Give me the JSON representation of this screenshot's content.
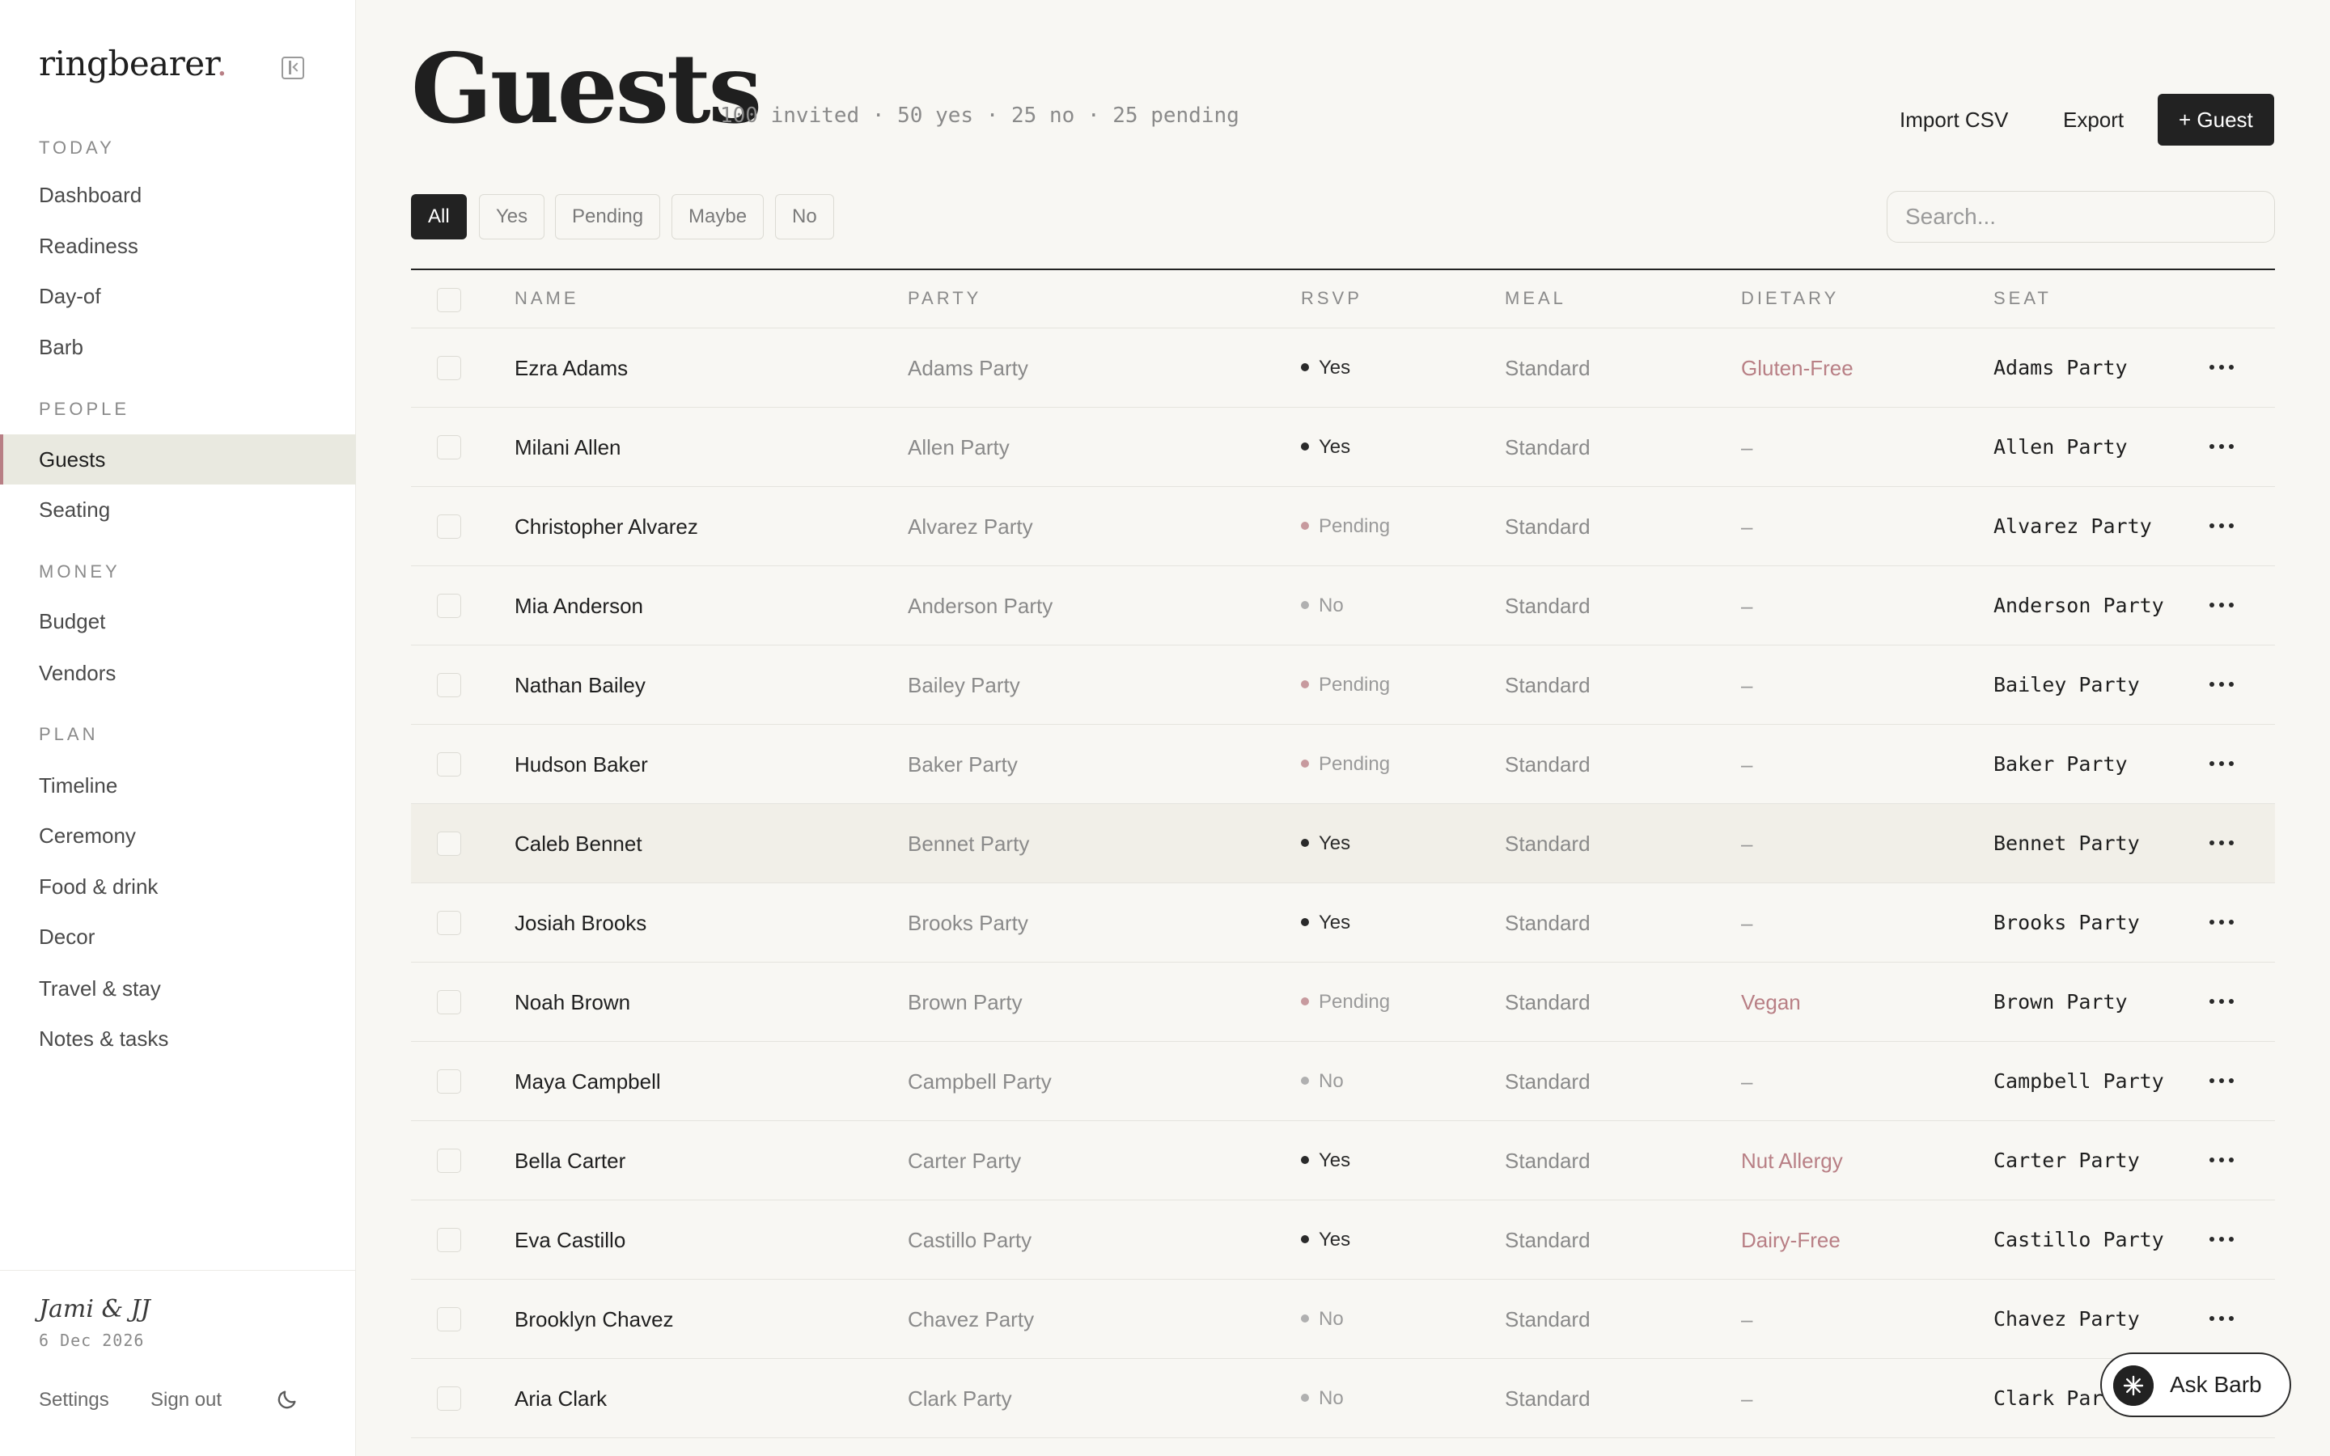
{
  "brand": {
    "name": "ringbearer",
    "dot": "."
  },
  "sidebar": {
    "sections": [
      {
        "title": "TODAY",
        "items": [
          "Dashboard",
          "Readiness",
          "Day-of",
          "Barb"
        ]
      },
      {
        "title": "PEOPLE",
        "items": [
          "Guests",
          "Seating"
        ]
      },
      {
        "title": "MONEY",
        "items": [
          "Budget",
          "Vendors"
        ]
      },
      {
        "title": "PLAN",
        "items": [
          "Timeline",
          "Ceremony",
          "Food & drink",
          "Decor",
          "Travel & stay",
          "Notes & tasks"
        ]
      }
    ],
    "active_item": "Guests",
    "footer": {
      "couple": "Jami & JJ",
      "date": "6 Dec 2026",
      "settings_label": "Settings",
      "signout_label": "Sign out"
    }
  },
  "header": {
    "title": "Guests",
    "stats": "100 invited · 50 yes · 25 no · 25 pending",
    "import_label": "Import CSV",
    "export_label": "Export",
    "add_label": "+ Guest"
  },
  "filters": {
    "options": [
      "All",
      "Yes",
      "Pending",
      "Maybe",
      "No"
    ],
    "selected": "All"
  },
  "search": {
    "placeholder": "Search...",
    "value": ""
  },
  "table": {
    "columns": [
      "NAME",
      "PARTY",
      "RSVP",
      "MEAL",
      "DIETARY",
      "SEAT"
    ],
    "rows": [
      {
        "name": "Ezra Adams",
        "party": "Adams Party",
        "rsvp": "Yes",
        "meal": "Standard",
        "dietary": "Gluten-Free",
        "seat": "Adams Party"
      },
      {
        "name": "Milani Allen",
        "party": "Allen Party",
        "rsvp": "Yes",
        "meal": "Standard",
        "dietary": "–",
        "seat": "Allen Party"
      },
      {
        "name": "Christopher Alvarez",
        "party": "Alvarez Party",
        "rsvp": "Pending",
        "meal": "Standard",
        "dietary": "–",
        "seat": "Alvarez Party"
      },
      {
        "name": "Mia Anderson",
        "party": "Anderson Party",
        "rsvp": "No",
        "meal": "Standard",
        "dietary": "–",
        "seat": "Anderson Party"
      },
      {
        "name": "Nathan Bailey",
        "party": "Bailey Party",
        "rsvp": "Pending",
        "meal": "Standard",
        "dietary": "–",
        "seat": "Bailey Party"
      },
      {
        "name": "Hudson Baker",
        "party": "Baker Party",
        "rsvp": "Pending",
        "meal": "Standard",
        "dietary": "–",
        "seat": "Baker Party"
      },
      {
        "name": "Caleb Bennet",
        "party": "Bennet Party",
        "rsvp": "Yes",
        "meal": "Standard",
        "dietary": "–",
        "seat": "Bennet Party"
      },
      {
        "name": "Josiah Brooks",
        "party": "Brooks Party",
        "rsvp": "Yes",
        "meal": "Standard",
        "dietary": "–",
        "seat": "Brooks Party"
      },
      {
        "name": "Noah Brown",
        "party": "Brown Party",
        "rsvp": "Pending",
        "meal": "Standard",
        "dietary": "Vegan",
        "seat": "Brown Party"
      },
      {
        "name": "Maya Campbell",
        "party": "Campbell Party",
        "rsvp": "No",
        "meal": "Standard",
        "dietary": "–",
        "seat": "Campbell Party"
      },
      {
        "name": "Bella Carter",
        "party": "Carter Party",
        "rsvp": "Yes",
        "meal": "Standard",
        "dietary": "Nut Allergy",
        "seat": "Carter Party"
      },
      {
        "name": "Eva Castillo",
        "party": "Castillo Party",
        "rsvp": "Yes",
        "meal": "Standard",
        "dietary": "Dairy-Free",
        "seat": "Castillo Party"
      },
      {
        "name": "Brooklyn Chavez",
        "party": "Chavez Party",
        "rsvp": "No",
        "meal": "Standard",
        "dietary": "–",
        "seat": "Chavez Party"
      },
      {
        "name": "Aria Clark",
        "party": "Clark Party",
        "rsvp": "No",
        "meal": "Standard",
        "dietary": "–",
        "seat": "Clark Party"
      }
    ]
  },
  "ask_barb": {
    "label": "Ask Barb"
  },
  "icons": {
    "collapse": "sidebar-collapse-icon",
    "theme": "moon-icon",
    "row_menu": "more-horizontal-icon",
    "assistant": "sparkle-icon"
  },
  "colors": {
    "accent": "#b87f85",
    "primary_button": "#222222",
    "background": "#f8f7f3"
  }
}
